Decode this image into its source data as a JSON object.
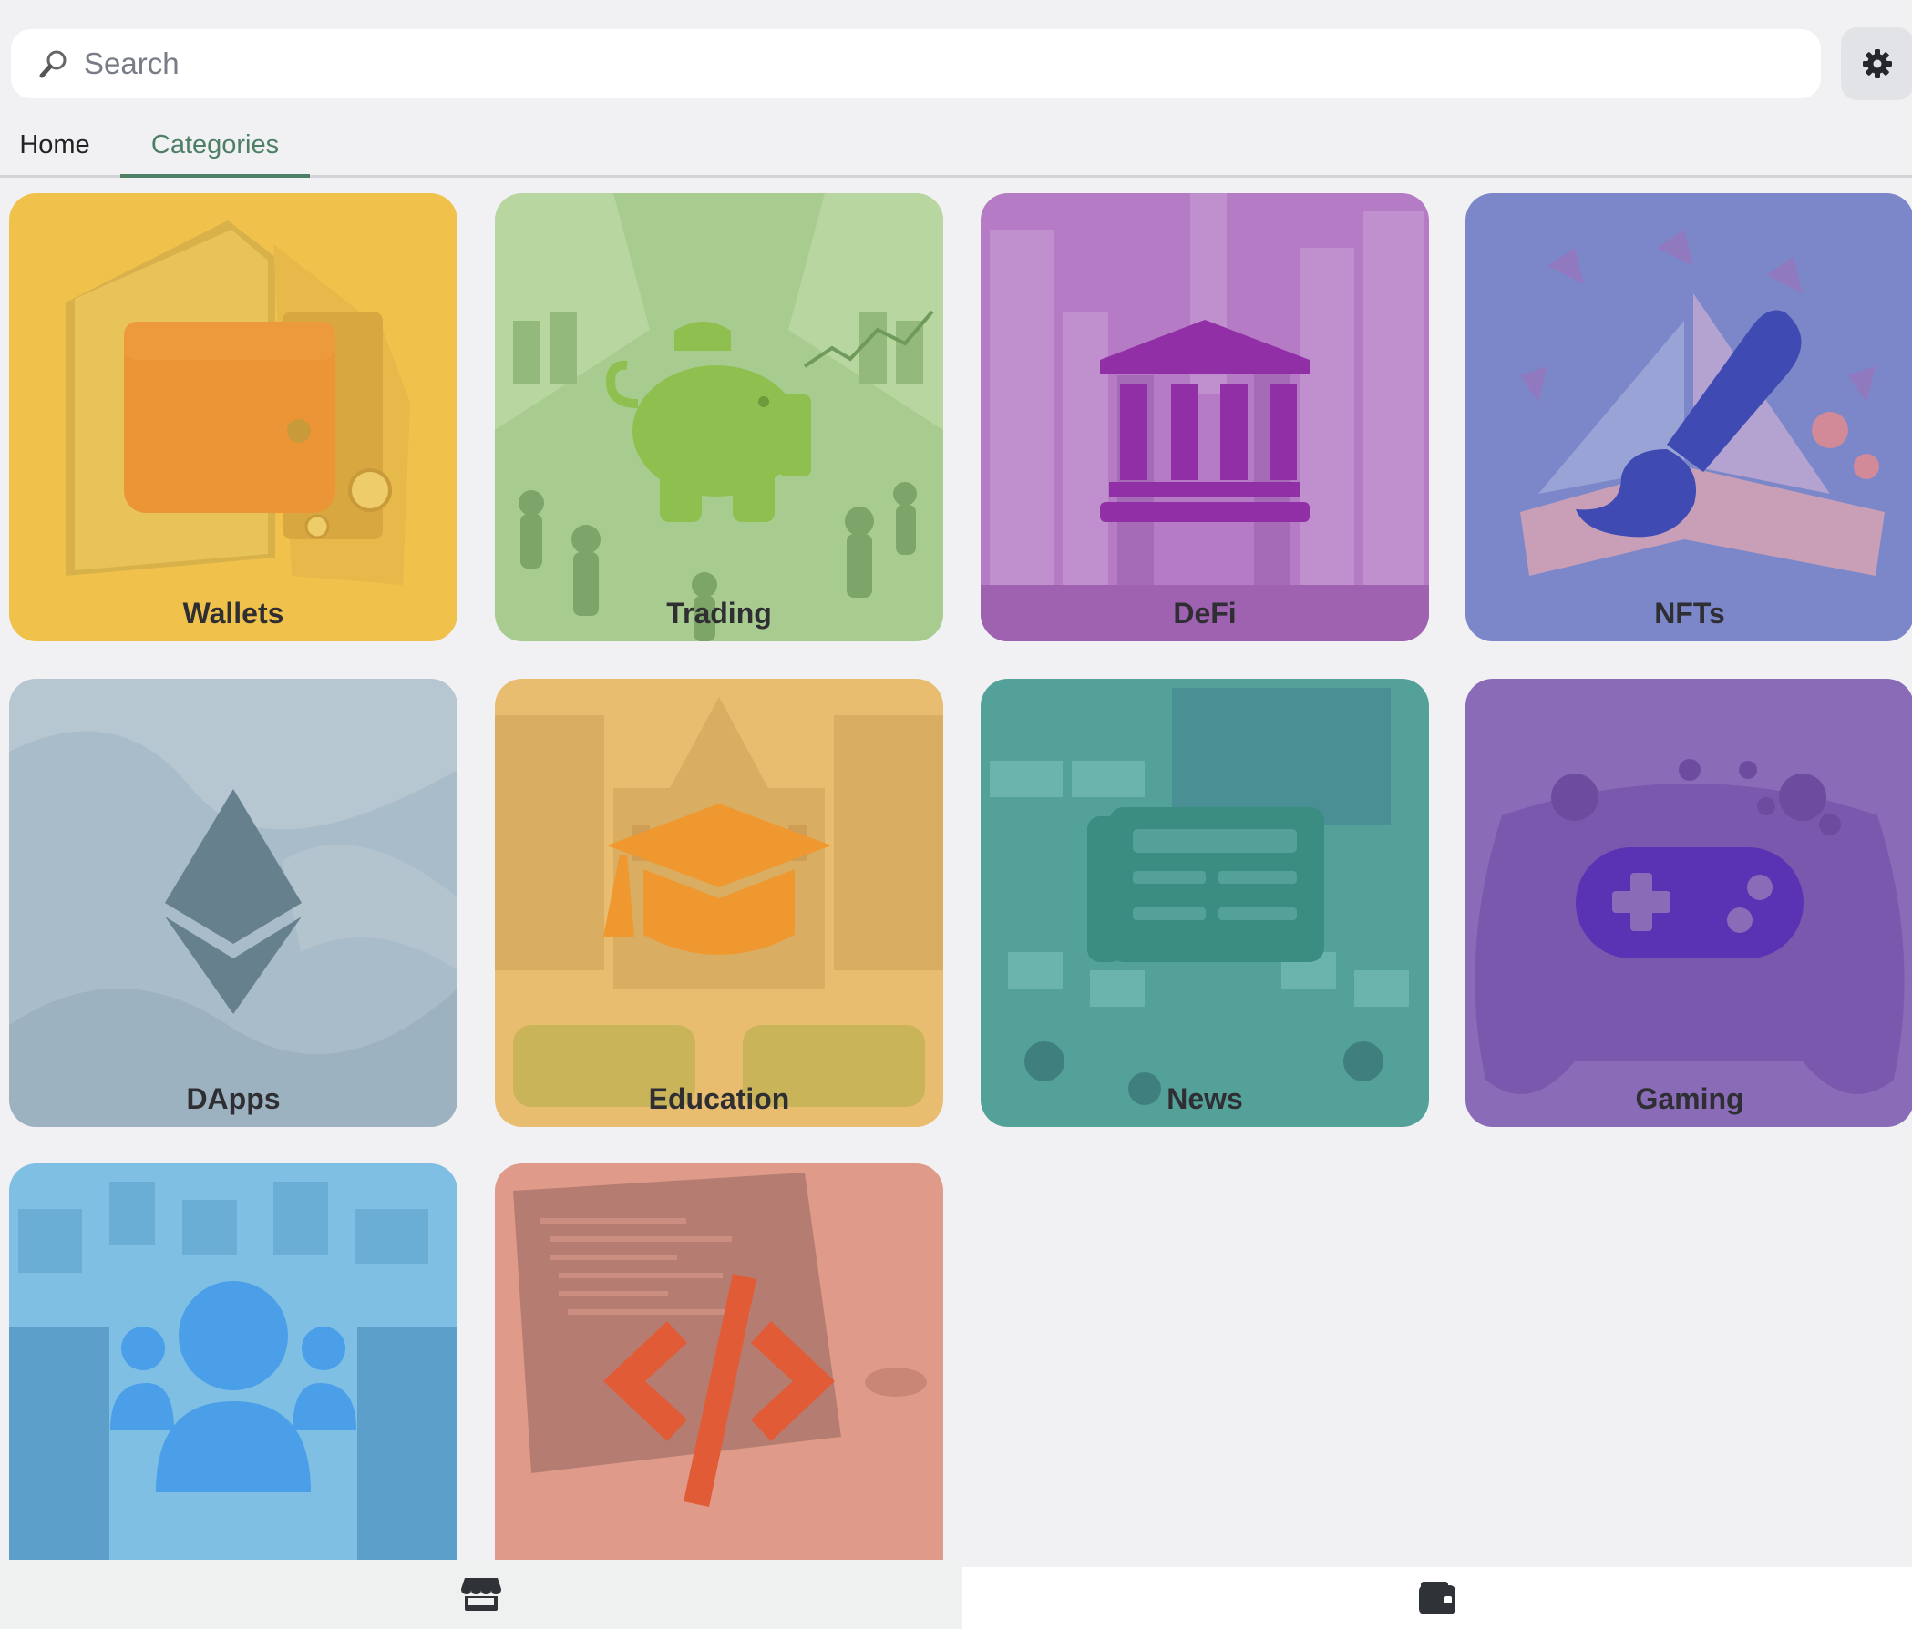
{
  "search": {
    "placeholder": "Search"
  },
  "header": {
    "settings_icon": "gear-icon"
  },
  "tabs": [
    {
      "label": "Home",
      "active": false
    },
    {
      "label": "Categories",
      "active": true
    }
  ],
  "categories": [
    {
      "label": "Wallets",
      "icon": "wallet-icon",
      "color": "#f0c24b"
    },
    {
      "label": "Trading",
      "icon": "piggy-bank-icon",
      "color": "#a8cc8f"
    },
    {
      "label": "DeFi",
      "icon": "bank-icon",
      "color": "#b57bc4"
    },
    {
      "label": "NFTs",
      "icon": "paintbrush-icon",
      "color": "#7b87c9"
    },
    {
      "label": "DApps",
      "icon": "ethereum-icon",
      "color": "#a9bcc9"
    },
    {
      "label": "Education",
      "icon": "graduation-cap-icon",
      "color": "#e9bd6f"
    },
    {
      "label": "News",
      "icon": "newspaper-icon",
      "color": "#53a199"
    },
    {
      "label": "Gaming",
      "icon": "gamepad-icon",
      "color": "#8a6bb8"
    },
    {
      "label": "",
      "icon": "users-icon",
      "color": "#7fbfe4"
    },
    {
      "label": "",
      "icon": "code-icon",
      "color": "#e09a8a"
    }
  ],
  "bottom_nav": [
    {
      "icon": "store-icon",
      "active": true
    },
    {
      "icon": "wallet-icon",
      "active": false
    }
  ]
}
